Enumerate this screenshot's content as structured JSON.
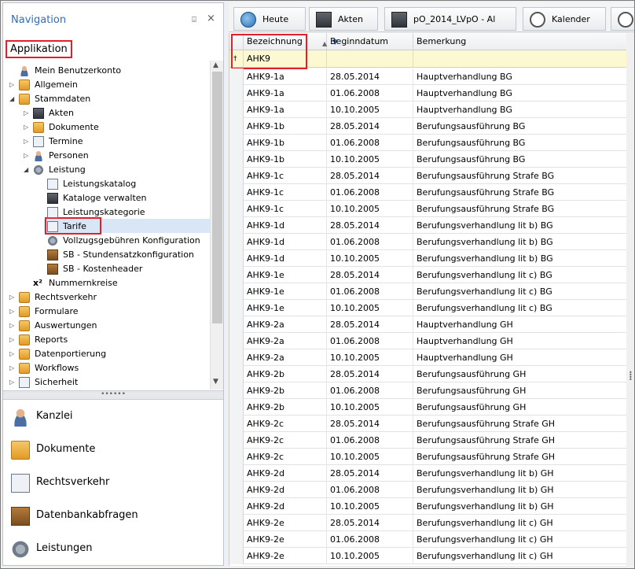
{
  "navigation": {
    "title": "Navigation",
    "pin_glyph": "⌹",
    "close_glyph": "×",
    "app_label": "Applikation",
    "tree": [
      {
        "label": "Mein Benutzerkonto",
        "level": 0,
        "arrow": "",
        "icon": "user-icon"
      },
      {
        "label": "Allgemein",
        "level": 0,
        "arrow": "▷",
        "icon": "folder-icon"
      },
      {
        "label": "Stammdaten",
        "level": 0,
        "arrow": "◢",
        "icon": "folder-icon"
      },
      {
        "label": "Akten",
        "level": 1,
        "arrow": "▷",
        "icon": "file-cabinet-icon"
      },
      {
        "label": "Dokumente",
        "level": 1,
        "arrow": "▷",
        "icon": "folder-icon"
      },
      {
        "label": "Termine",
        "level": 1,
        "arrow": "▷",
        "icon": "calendar-icon"
      },
      {
        "label": "Personen",
        "level": 1,
        "arrow": "▷",
        "icon": "people-icon"
      },
      {
        "label": "Leistung",
        "level": 1,
        "arrow": "◢",
        "icon": "gear-icon"
      },
      {
        "label": "Leistungskatalog",
        "level": 2,
        "arrow": "",
        "icon": "catalog-icon"
      },
      {
        "label": "Kataloge verwalten",
        "level": 2,
        "arrow": "",
        "icon": "book-icon"
      },
      {
        "label": "Leistungskategorie",
        "level": 2,
        "arrow": "",
        "icon": "list-icon"
      },
      {
        "label": "Tarife",
        "level": 2,
        "arrow": "",
        "icon": "tariff-icon"
      },
      {
        "label": "Vollzugsgebühren Konfiguration",
        "level": 2,
        "arrow": "",
        "icon": "gear-icon"
      },
      {
        "label": "SB - Stundensatzkonfiguration",
        "level": 2,
        "arrow": "",
        "icon": "box-icon"
      },
      {
        "label": "SB - Kostenheader",
        "level": 2,
        "arrow": "",
        "icon": "box-icon"
      },
      {
        "label": "Nummernkreise",
        "level": 1,
        "arrow": "",
        "icon": "superscript-icon"
      },
      {
        "label": "Rechtsverkehr",
        "level": 0,
        "arrow": "▷",
        "icon": "folder-icon"
      },
      {
        "label": "Formulare",
        "level": 0,
        "arrow": "▷",
        "icon": "folder-icon"
      },
      {
        "label": "Auswertungen",
        "level": 0,
        "arrow": "▷",
        "icon": "folder-icon"
      },
      {
        "label": "Reports",
        "level": 0,
        "arrow": "▷",
        "icon": "folder-icon"
      },
      {
        "label": "Datenportierung",
        "level": 0,
        "arrow": "▷",
        "icon": "folder-icon"
      },
      {
        "label": "Workflows",
        "level": 0,
        "arrow": "▷",
        "icon": "folder-icon"
      },
      {
        "label": "Sicherheit",
        "level": 0,
        "arrow": "▷",
        "icon": "shield-icon"
      }
    ],
    "selected_item": "Tarife",
    "splitter_glyph": "••••••",
    "big_items": [
      {
        "label": "Kanzlei",
        "icon": "people-icon"
      },
      {
        "label": "Dokumente",
        "icon": "folder-icon"
      },
      {
        "label": "Rechtsverkehr",
        "icon": "envelope-icon"
      },
      {
        "label": "Datenbankabfragen",
        "icon": "database-icon"
      },
      {
        "label": "Leistungen",
        "icon": "gear-icon"
      }
    ]
  },
  "tabs": [
    {
      "label": "Heute",
      "icon": "globe-icon"
    },
    {
      "label": "Akten",
      "icon": "file-cabinet-icon"
    },
    {
      "label": "pO_2014_LVpO - Al",
      "icon": "file-cabinet-icon"
    },
    {
      "label": "Kalender",
      "icon": "clock-icon"
    },
    {
      "label": "",
      "icon": "clock-icon"
    }
  ],
  "grid": {
    "columns": [
      "Bezeichnung",
      "Beginndatum",
      "Bemerkung"
    ],
    "sort_glyph": "▲",
    "filter_glyph": "▼",
    "filter_indicator": "†",
    "filter_value": "AHK9",
    "rows": [
      [
        "AHK9-1a",
        "28.05.2014",
        "Hauptverhandlung BG"
      ],
      [
        "AHK9-1a",
        "01.06.2008",
        "Hauptverhandlung BG"
      ],
      [
        "AHK9-1a",
        "10.10.2005",
        "Hauptverhandlung BG"
      ],
      [
        "AHK9-1b",
        "28.05.2014",
        "Berufungsausführung BG"
      ],
      [
        "AHK9-1b",
        "01.06.2008",
        "Berufungsausführung BG"
      ],
      [
        "AHK9-1b",
        "10.10.2005",
        "Berufungsausführung BG"
      ],
      [
        "AHK9-1c",
        "28.05.2014",
        "Berufungsausführung Strafe BG"
      ],
      [
        "AHK9-1c",
        "01.06.2008",
        "Berufungsausführung Strafe BG"
      ],
      [
        "AHK9-1c",
        "10.10.2005",
        "Berufungsausführung Strafe BG"
      ],
      [
        "AHK9-1d",
        "28.05.2014",
        "Berufungsverhandlung lit b) BG"
      ],
      [
        "AHK9-1d",
        "01.06.2008",
        "Berufungsverhandlung lit b) BG"
      ],
      [
        "AHK9-1d",
        "10.10.2005",
        "Berufungsverhandlung lit b) BG"
      ],
      [
        "AHK9-1e",
        "28.05.2014",
        "Berufungsverhandlung lit c) BG"
      ],
      [
        "AHK9-1e",
        "01.06.2008",
        "Berufungsverhandlung lit c) BG"
      ],
      [
        "AHK9-1e",
        "10.10.2005",
        "Berufungsverhandlung lit c) BG"
      ],
      [
        "AHK9-2a",
        "28.05.2014",
        "Hauptverhandlung GH"
      ],
      [
        "AHK9-2a",
        "01.06.2008",
        "Hauptverhandlung GH"
      ],
      [
        "AHK9-2a",
        "10.10.2005",
        "Hauptverhandlung GH"
      ],
      [
        "AHK9-2b",
        "28.05.2014",
        "Berufungsausführung GH"
      ],
      [
        "AHK9-2b",
        "01.06.2008",
        "Berufungsausführung GH"
      ],
      [
        "AHK9-2b",
        "10.10.2005",
        "Berufungsausführung GH"
      ],
      [
        "AHK9-2c",
        "28.05.2014",
        "Berufungsausführung Strafe GH"
      ],
      [
        "AHK9-2c",
        "01.06.2008",
        "Berufungsausführung Strafe GH"
      ],
      [
        "AHK9-2c",
        "10.10.2005",
        "Berufungsausführung Strafe GH"
      ],
      [
        "AHK9-2d",
        "28.05.2014",
        "Berufungsverhandlung lit b) GH"
      ],
      [
        "AHK9-2d",
        "01.06.2008",
        "Berufungsverhandlung lit b) GH"
      ],
      [
        "AHK9-2d",
        "10.10.2005",
        "Berufungsverhandlung lit b) GH"
      ],
      [
        "AHK9-2e",
        "28.05.2014",
        "Berufungsverhandlung lit c) GH"
      ],
      [
        "AHK9-2e",
        "01.06.2008",
        "Berufungsverhandlung lit c) GH"
      ],
      [
        "AHK9-2e",
        "10.10.2005",
        "Berufungsverhandlung lit c) GH"
      ]
    ]
  },
  "colors": {
    "accent": "#2a6ec6",
    "highlight_box": "#e0202a",
    "filter_row": "#fcf8d2",
    "selection": "#d9e6f5"
  }
}
